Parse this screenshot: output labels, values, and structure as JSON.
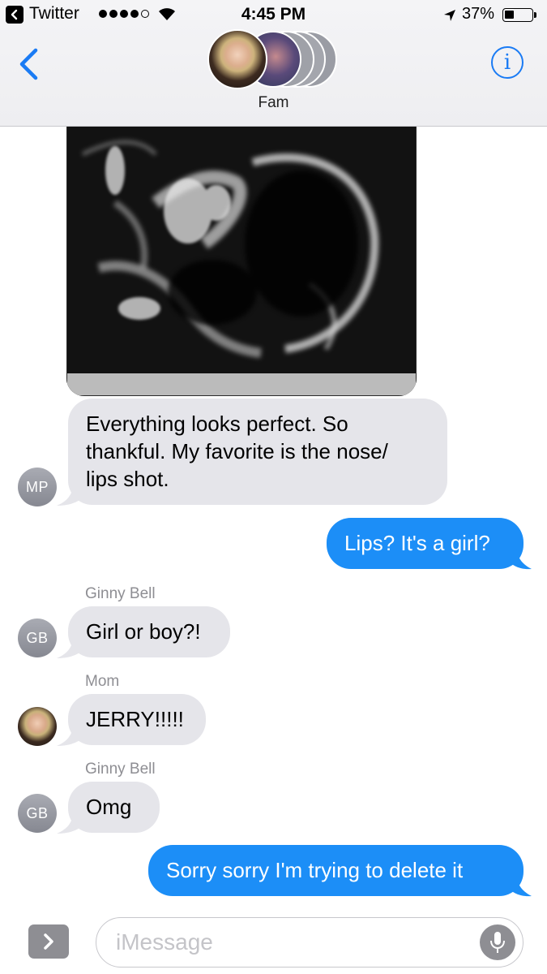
{
  "status_bar": {
    "app_back_label": "Twitter",
    "time": "4:45 PM",
    "battery": "37%",
    "battery_level": 0.37,
    "signal_bars": 4,
    "signal_total": 5
  },
  "nav": {
    "group_name": "Fam",
    "info_glyph": "i",
    "back_icon": "chevron-left-icon"
  },
  "messages": [
    {
      "type": "photo",
      "direction": "in",
      "description_icon": "ultrasound-photo"
    },
    {
      "type": "text",
      "direction": "in",
      "sender": "",
      "avatar": "MP",
      "text_lines": [
        "Everything looks perfect. So",
        "thankful. My favorite is the nose/",
        "lips shot."
      ]
    },
    {
      "type": "text",
      "direction": "out",
      "text": "Lips? It's a girl?"
    },
    {
      "type": "text",
      "direction": "in",
      "sender": "Ginny Bell",
      "avatar": "GB",
      "text": "Girl or boy?!"
    },
    {
      "type": "text",
      "direction": "in",
      "sender": "Mom",
      "avatar": "photo",
      "text": "JERRY!!!!!"
    },
    {
      "type": "text",
      "direction": "in",
      "sender": "Ginny Bell",
      "avatar": "GB",
      "text": "Omg"
    },
    {
      "type": "text",
      "direction": "out",
      "text": "Sorry sorry I'm trying to delete it"
    }
  ],
  "composer": {
    "placeholder": "iMessage"
  },
  "colors": {
    "ios_blue": "#1c8ef7",
    "incoming_bubble": "#e5e5ea",
    "secondary_text": "#8e8e93"
  }
}
